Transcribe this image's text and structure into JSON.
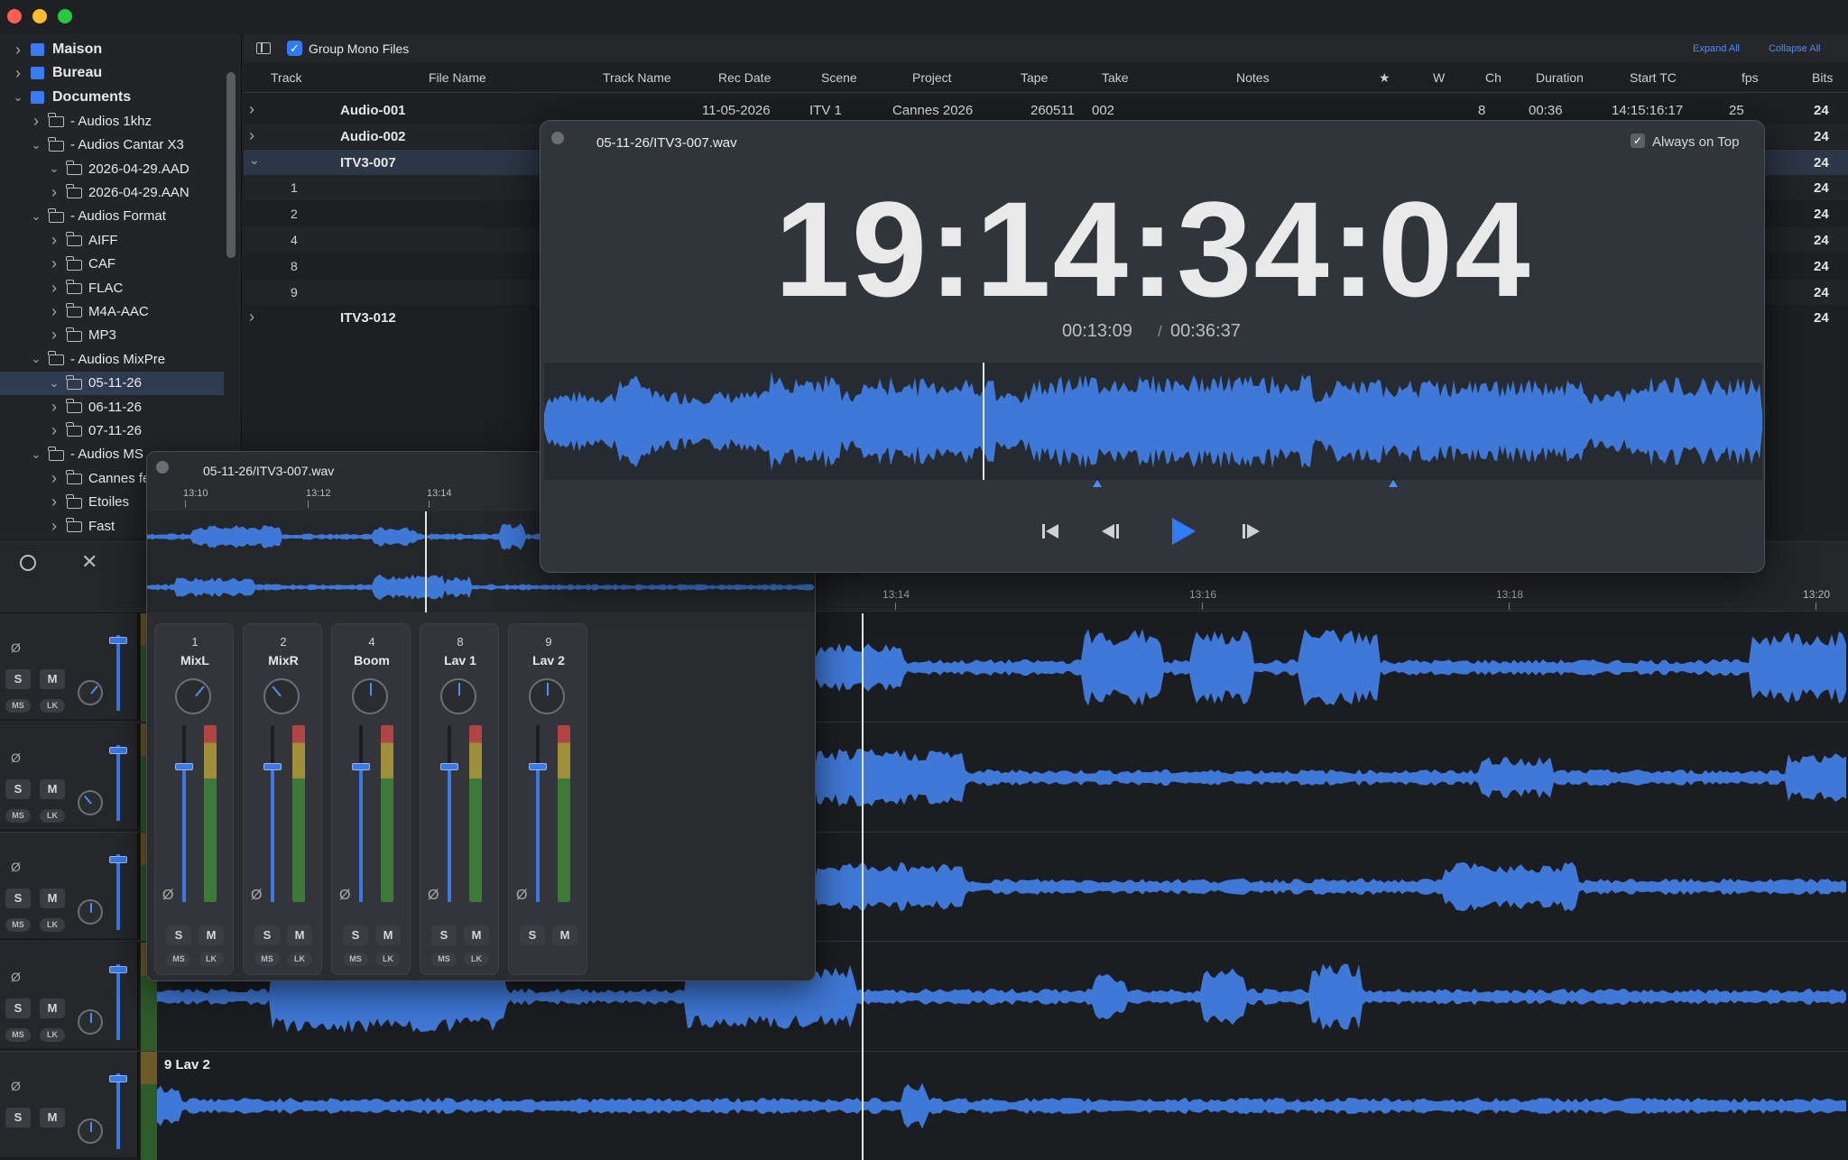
{
  "window": {
    "traffic_colors": [
      "#ff5f57",
      "#febc2e",
      "#28c840"
    ]
  },
  "sidebar": {
    "items": [
      {
        "label": "Maison",
        "icon": "home-icon"
      },
      {
        "label": "Bureau",
        "icon": "desktop-icon"
      },
      {
        "label": "Documents",
        "icon": "document-icon"
      },
      {
        "label": "- Audios 1khz"
      },
      {
        "label": "- Audios Cantar X3"
      },
      {
        "label": "2026-04-29.AAD"
      },
      {
        "label": "2026-04-29.AAN"
      },
      {
        "label": "- Audios Format"
      },
      {
        "label": "AIFF"
      },
      {
        "label": "CAF"
      },
      {
        "label": "FLAC"
      },
      {
        "label": "M4A-AAC"
      },
      {
        "label": "MP3"
      },
      {
        "label": "- Audios MixPre"
      },
      {
        "label": "05-11-26"
      },
      {
        "label": "06-11-26"
      },
      {
        "label": "07-11-26"
      },
      {
        "label": "- Audios MS"
      },
      {
        "label": "Cannes fe"
      },
      {
        "label": "Etoiles"
      },
      {
        "label": "Fast"
      }
    ]
  },
  "toolbar": {
    "group_mono_label": "Group Mono Files",
    "expand_all": "Expand All",
    "collapse_all": "Collapse All"
  },
  "table": {
    "headers": [
      "Track",
      "File Name",
      "Track Name",
      "Rec Date",
      "Scene",
      "Project",
      "Tape",
      "Take",
      "Notes",
      "★",
      "W",
      "Ch",
      "Duration",
      "Start TC",
      "fps",
      "Bits"
    ],
    "rows": [
      {
        "track": "Audio-001",
        "rec_date": "11-05-2026",
        "scene": "ITV 1",
        "project": "Cannes 2026",
        "tape": "260511",
        "take": "002",
        "ch": "8",
        "duration": "00:36",
        "start_tc": "14:15:16:17",
        "fps": "25",
        "bits": "24"
      },
      {
        "track": "Audio-002",
        "bits": "24"
      },
      {
        "track": "ITV3-007",
        "bits": "24"
      },
      {
        "track": "1",
        "bits": "24"
      },
      {
        "track": "2",
        "bits": "24"
      },
      {
        "track": "4",
        "bits": "24"
      },
      {
        "track": "8",
        "bits": "24"
      },
      {
        "track": "9",
        "bits": "24"
      },
      {
        "track": "ITV3-012",
        "bits": "24"
      }
    ]
  },
  "timecode_window": {
    "title": "05-11-26/ITV3-007.wav",
    "always_on_top": "Always on Top",
    "timecode": "19:14:34:04",
    "elapsed": "00:13:09",
    "separator": "/",
    "total": "00:36:37",
    "playhead_fraction": 0.36
  },
  "mixer_window": {
    "title": "05-11-26/ITV3-007.wav",
    "ruler": [
      "13:10",
      "13:12",
      "13:14"
    ],
    "strips": [
      {
        "num": "1",
        "name": "MixL"
      },
      {
        "num": "2",
        "name": "MixR"
      },
      {
        "num": "4",
        "name": "Boom"
      },
      {
        "num": "8",
        "name": "Lav 1"
      },
      {
        "num": "9",
        "name": "Lav 2"
      }
    ]
  },
  "timeline": {
    "ruler": [
      "13:14",
      "13:16",
      "13:18",
      "13:20"
    ],
    "last_lane_label": "9 Lav 2"
  },
  "buttons": {
    "solo": "S",
    "mute": "M",
    "ms": "MS",
    "lk": "LK",
    "phase": "Ø"
  },
  "accent": "#4f8ef7",
  "wave_color": "#3f78d6"
}
